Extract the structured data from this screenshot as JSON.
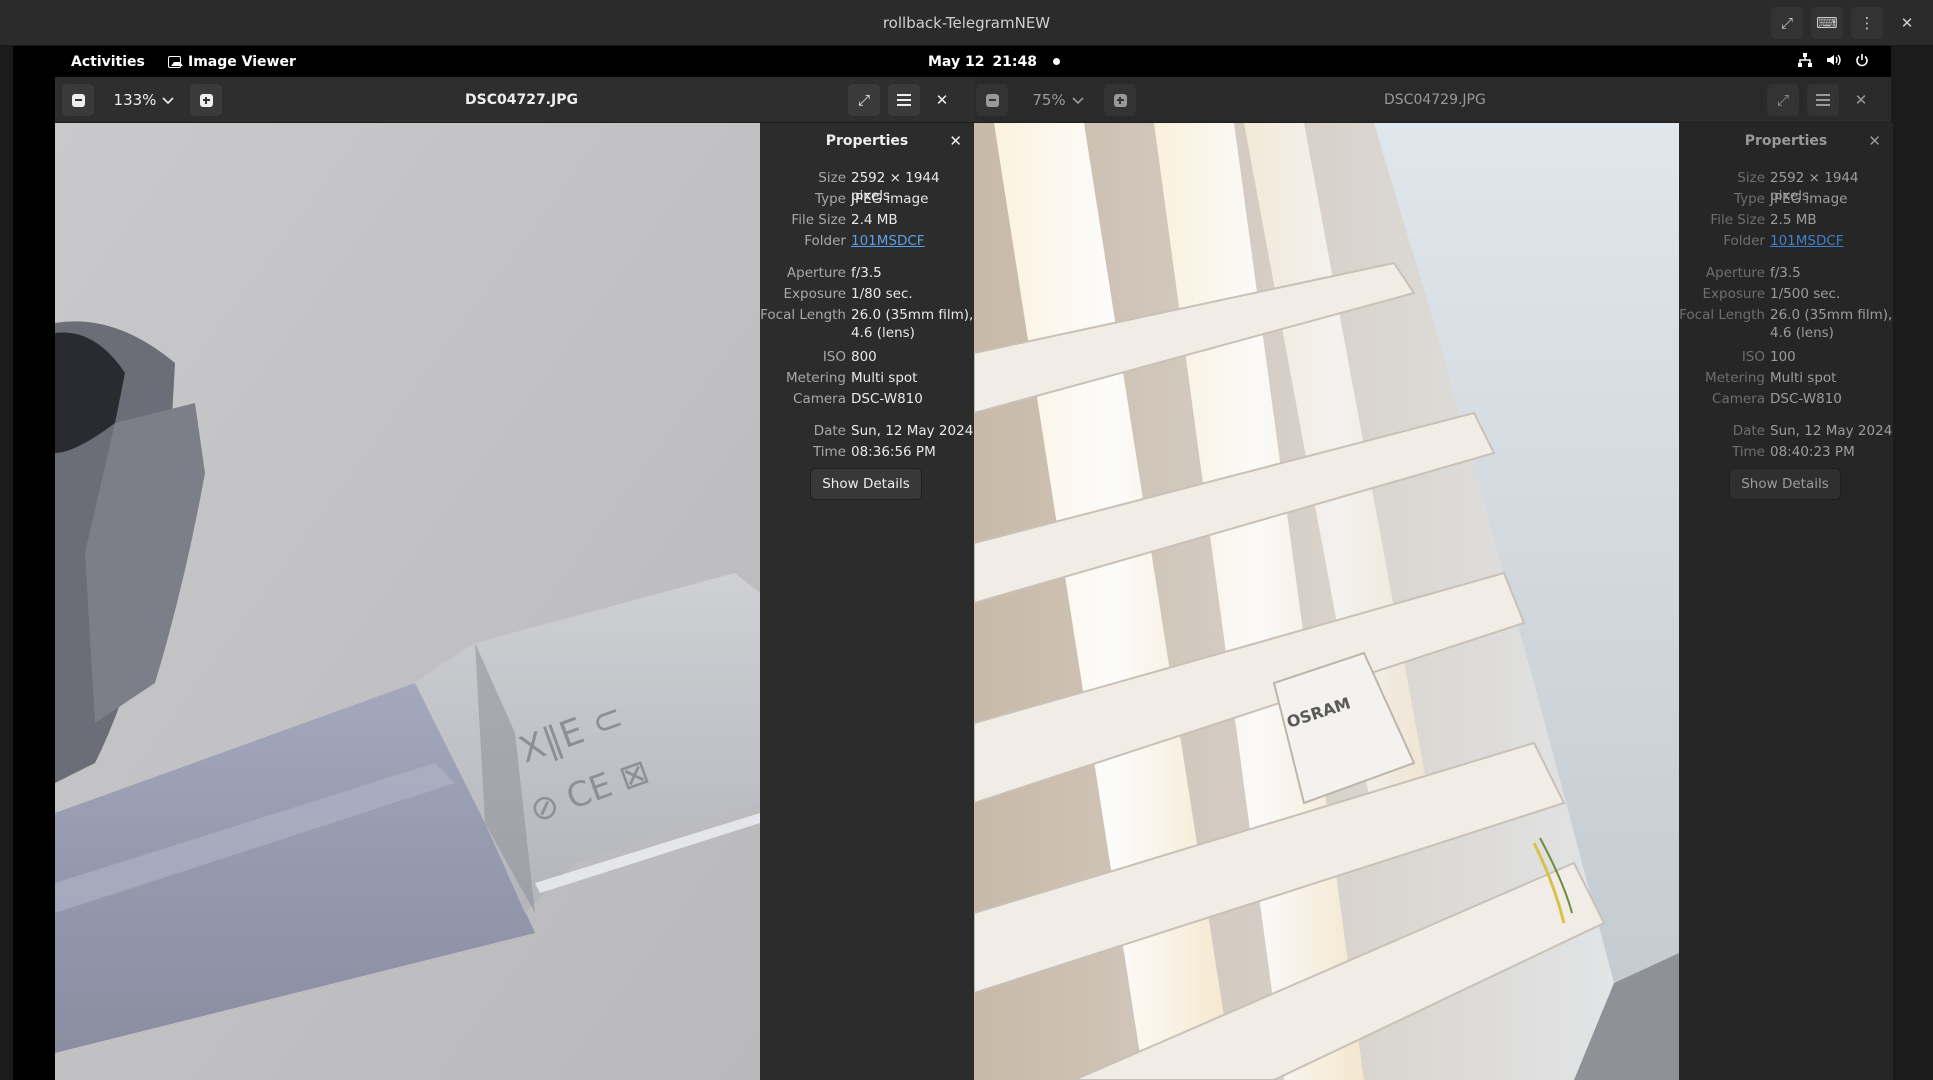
{
  "host": {
    "title": "rollback-TelegramNEW",
    "controls": {
      "fullscreen_icon": "fullscreen-icon",
      "keyboard_icon": "keyboard-icon",
      "menu_icon": "kebab-menu-icon",
      "close_icon": "close-icon"
    }
  },
  "gnome": {
    "activities": "Activities",
    "app_name": "Image Viewer",
    "date": "May 12",
    "time": "21:48",
    "tray": {
      "network_icon": "network-icon",
      "volume_icon": "volume-icon",
      "power_icon": "power-icon"
    }
  },
  "left_viewer": {
    "zoom": "133%",
    "filename": "DSC04727.JPG",
    "properties": {
      "title": "Properties",
      "size_label": "Size",
      "size": "2592 × 1944 pixels",
      "type_label": "Type",
      "type": "JPEG image",
      "filesize_label": "File Size",
      "filesize": "2.4 MB",
      "folder_label": "Folder",
      "folder": "101MSDCF",
      "aperture_label": "Aperture",
      "aperture": "f/3.5",
      "exposure_label": "Exposure",
      "exposure": "1/80 sec.",
      "focal_label": "Focal Length",
      "focal": "26.0 (35mm film), 4.6 (lens)",
      "iso_label": "ISO",
      "iso": "800",
      "metering_label": "Metering",
      "metering": "Multi spot",
      "camera_label": "Camera",
      "camera": "DSC-W810",
      "date_label": "Date",
      "date": "Sun, 12 May 2024",
      "time_label": "Time",
      "time": "08:36:56 PM",
      "show_details": "Show Details"
    }
  },
  "right_viewer": {
    "zoom": "75%",
    "filename": "DSC04729.JPG",
    "properties": {
      "title": "Properties",
      "size_label": "Size",
      "size": "2592 × 1944 pixels",
      "type_label": "Type",
      "type": "JPEG image",
      "filesize_label": "File Size",
      "filesize": "2.5 MB",
      "folder_label": "Folder",
      "folder": "101MSDCF",
      "aperture_label": "Aperture",
      "aperture": "f/3.5",
      "exposure_label": "Exposure",
      "exposure": "1/500 sec.",
      "focal_label": "Focal Length",
      "focal": "26.0 (35mm film), 4.6 (lens)",
      "iso_label": "ISO",
      "iso": "100",
      "metering_label": "Metering",
      "metering": "Multi spot",
      "camera_label": "Camera",
      "camera": "DSC-W810",
      "date_label": "Date",
      "date": "Sun, 12 May 2024",
      "time_label": "Time",
      "time": "08:40:23 PM",
      "show_details": "Show Details"
    }
  }
}
